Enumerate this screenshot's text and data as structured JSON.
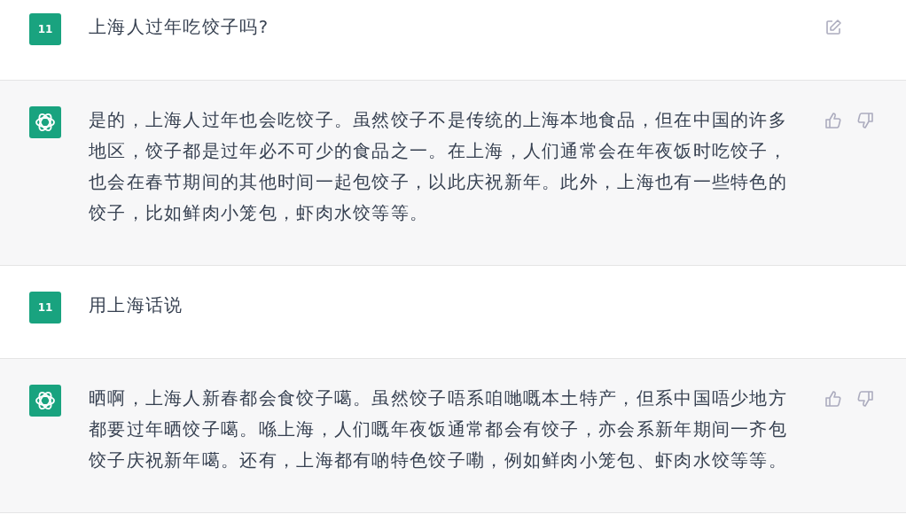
{
  "messages": [
    {
      "kind": "user",
      "avatar": "11",
      "text": "上海人过年吃饺子吗?",
      "editable": true
    },
    {
      "kind": "assistant",
      "text": "是的，上海人过年也会吃饺子。虽然饺子不是传统的上海本地食品，但在中国的许多地区，饺子都是过年必不可少的食品之一。在上海，人们通常会在年夜饭时吃饺子，也会在春节期间的其他时间一起包饺子，以此庆祝新年。此外，上海也有一些特色的饺子，比如鲜肉小笼包，虾肉水饺等等。"
    },
    {
      "kind": "user",
      "avatar": "11",
      "text": "用上海话说",
      "editable": false
    },
    {
      "kind": "assistant",
      "text": "晒啊，上海人新春都会食饺子噶。虽然饺子唔系咱哋嘅本土特产，但系中国唔少地方都要过年晒饺子噶。喺上海，人们嘅年夜饭通常都会有饺子，亦会系新年期间一齐包饺子庆祝新年噶。还有，上海都有啲特色饺子嘞，例如鲜肉小笼包、虾肉水饺等等。"
    }
  ]
}
